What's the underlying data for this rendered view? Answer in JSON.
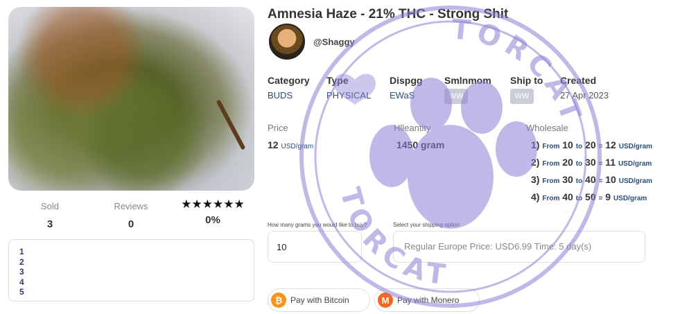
{
  "product": {
    "title": "Amnesia Haze - 21% THC - Strong Shit",
    "vendor": "@Shaggy"
  },
  "stats": {
    "sold_label": "Sold",
    "sold_value": "3",
    "reviews_label": "Reviews",
    "reviews_value": "0",
    "stars": "★★★★★★",
    "rating": "0%"
  },
  "notes": [
    "1",
    "2",
    "3",
    "4",
    "5"
  ],
  "meta": {
    "category_label": "Category",
    "category_value": "BUDS",
    "type_label": "Type",
    "type_value": "PHYSICAL",
    "dispatch_label": "Dispgg",
    "dispatch_value": "EWaS",
    "shipfrom_label": "Smlnmom",
    "shipfrom_flag": "WW",
    "shipto_label": "Ship to",
    "shipto_flag": "WW",
    "created_label": "Created",
    "created_value": "27 Apr 2023"
  },
  "pricing": {
    "price_label": "Price",
    "price_value": "12",
    "price_unit": "USD/gram",
    "quantity_label": "Hlleantity",
    "quantity_value": "1450 gram",
    "wholesale_label": "Wholesale",
    "tiers": [
      {
        "n": "1)",
        "from": "10",
        "to": "20",
        "price": "12"
      },
      {
        "n": "2)",
        "from": "20",
        "to": "30",
        "price": "11"
      },
      {
        "n": "3)",
        "from": "30",
        "to": "40",
        "price": "10"
      },
      {
        "n": "4)",
        "from": "40",
        "to": "50",
        "price": "9"
      }
    ],
    "from_word": "From",
    "to_word": "to",
    "eq": "=",
    "tier_unit": "USD/gram"
  },
  "order": {
    "qty_label": "How many grams you would like to buy?",
    "qty_value": "10",
    "ship_label": "Select your shipping option",
    "ship_value": "Regular Europe Price: USD6.99 Time: 5 day(s)"
  },
  "payment": {
    "btc_label": "Pay with Bitcoin",
    "xmr_label": "Pay with Monero"
  },
  "watermark": {
    "text_top": "TORCAT",
    "text_bottom": "TORCAT",
    "color": "#8f7fd6"
  }
}
